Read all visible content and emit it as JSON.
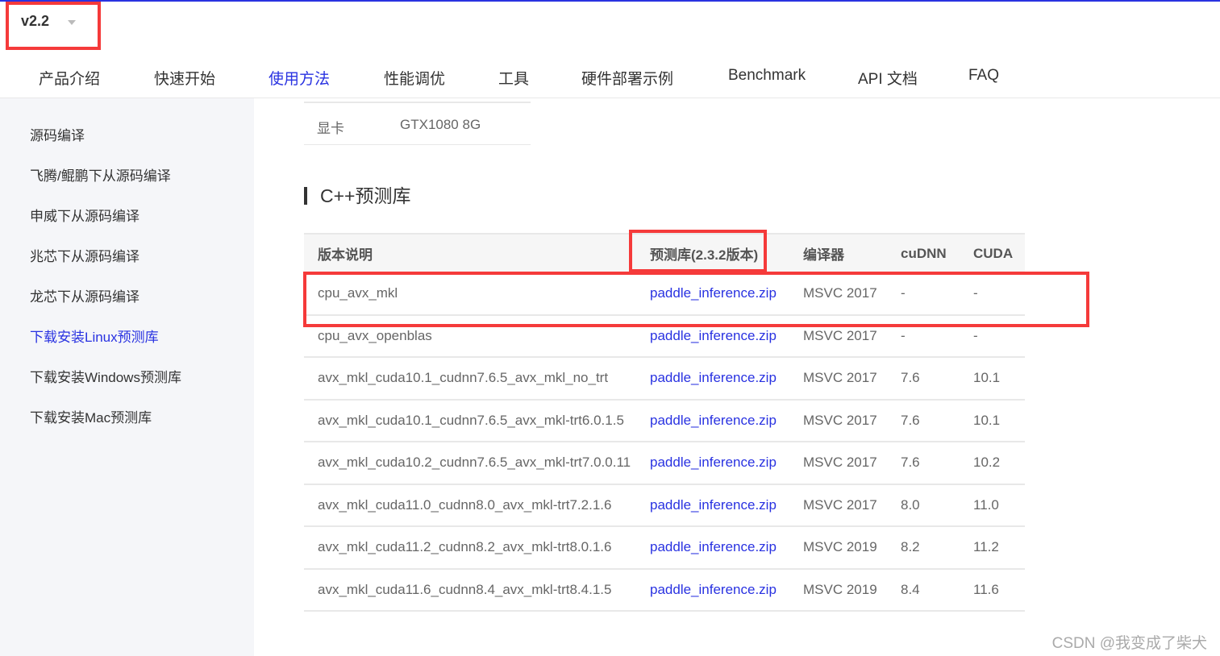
{
  "version": "v2.2",
  "nav": [
    "产品介绍",
    "快速开始",
    "使用方法",
    "性能调优",
    "工具",
    "硬件部署示例",
    "Benchmark",
    "API 文档",
    "FAQ"
  ],
  "sidebar": [
    "源码编译",
    "飞腾/鲲鹏下从源码编译",
    "申威下从源码编译",
    "兆芯下从源码编译",
    "龙芯下从源码编译",
    "下载安装Linux预测库",
    "下载安装Windows预测库",
    "下载安装Mac预测库"
  ],
  "gpu": {
    "label": "显卡",
    "value": "GTX1080 8G"
  },
  "section_title": "C++预测库",
  "table": {
    "headers": [
      "版本说明",
      "预测库(2.3.2版本)",
      "编译器",
      "cuDNN",
      "CUDA"
    ],
    "rows": [
      [
        "cpu_avx_mkl",
        "paddle_inference.zip",
        "MSVC 2017",
        "-",
        "-"
      ],
      [
        "cpu_avx_openblas",
        "paddle_inference.zip",
        "MSVC 2017",
        "-",
        "-"
      ],
      [
        "avx_mkl_cuda10.1_cudnn7.6.5_avx_mkl_no_trt",
        "paddle_inference.zip",
        "MSVC 2017",
        "7.6",
        "10.1"
      ],
      [
        "avx_mkl_cuda10.1_cudnn7.6.5_avx_mkl-trt6.0.1.5",
        "paddle_inference.zip",
        "MSVC 2017",
        "7.6",
        "10.1"
      ],
      [
        "avx_mkl_cuda10.2_cudnn7.6.5_avx_mkl-trt7.0.0.11",
        "paddle_inference.zip",
        "MSVC 2017",
        "7.6",
        "10.2"
      ],
      [
        "avx_mkl_cuda11.0_cudnn8.0_avx_mkl-trt7.2.1.6",
        "paddle_inference.zip",
        "MSVC 2017",
        "8.0",
        "11.0"
      ],
      [
        "avx_mkl_cuda11.2_cudnn8.2_avx_mkl-trt8.0.1.6",
        "paddle_inference.zip",
        "MSVC 2019",
        "8.2",
        "11.2"
      ],
      [
        "avx_mkl_cuda11.6_cudnn8.4_avx_mkl-trt8.4.1.5",
        "paddle_inference.zip",
        "MSVC 2019",
        "8.4",
        "11.6"
      ]
    ]
  },
  "watermark": "CSDN @我变成了柴犬"
}
